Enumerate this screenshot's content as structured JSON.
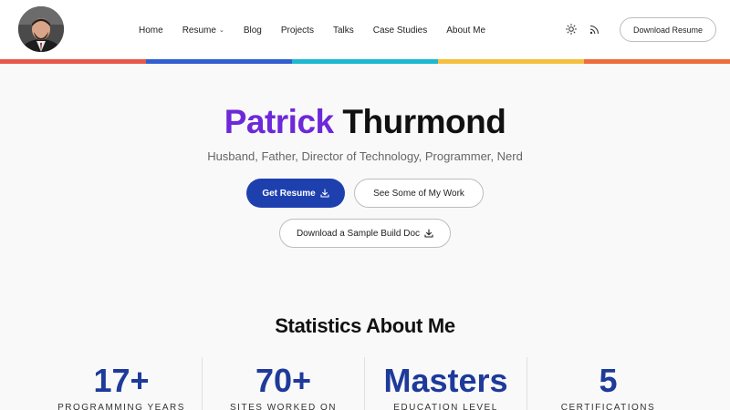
{
  "header": {
    "nav": [
      {
        "label": "Home"
      },
      {
        "label": "Resume",
        "has_dropdown": true
      },
      {
        "label": "Blog"
      },
      {
        "label": "Projects"
      },
      {
        "label": "Talks"
      },
      {
        "label": "Case Studies"
      },
      {
        "label": "About Me"
      }
    ],
    "dropdown_glyph": "⌄",
    "download_label": "Download Resume",
    "icons": [
      "sun-icon",
      "rss-icon"
    ]
  },
  "accent_bar_colors": [
    "#e8564a",
    "#2f5fd0",
    "#1bb8cf",
    "#f3bf3e",
    "#ee6d3b"
  ],
  "hero": {
    "first_name": "Patrick",
    "last_name": "Thurmond",
    "subtitle": "Husband, Father, Director of Technology, Programmer, Nerd",
    "get_resume_label": "Get Resume",
    "see_work_label": "See Some of My Work",
    "sample_doc_label": "Download a Sample Build Doc",
    "first_name_color": "#6d28d9",
    "primary_color": "#1e40af"
  },
  "stats": {
    "heading": "Statistics About Me",
    "items": [
      {
        "value": "17+",
        "label": "PROGRAMMING YEARS"
      },
      {
        "value": "70+",
        "label": "SITES WORKED ON"
      },
      {
        "value": "Masters",
        "label": "EDUCATION LEVEL"
      },
      {
        "value": "5",
        "label": "CERTIFICATIONS"
      }
    ],
    "value_color": "#1e3a9a"
  }
}
